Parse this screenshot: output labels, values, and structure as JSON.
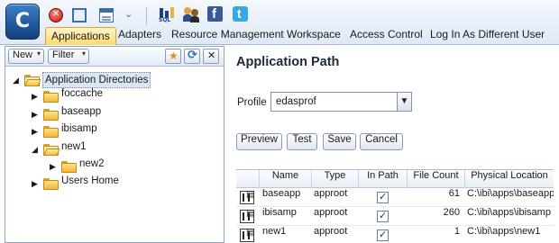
{
  "topbar": {
    "logo_letter": "C",
    "quick_tools": [
      "stop-icon",
      "window-icon",
      "window-list-icon",
      "chevron-down-icon",
      "sql-icon",
      "people-icon",
      "facebook-icon",
      "twitter-icon"
    ]
  },
  "menu": {
    "items": [
      {
        "label": "Applications",
        "active": true
      },
      {
        "label": "Adapters",
        "active": false
      },
      {
        "label": "Resource Management",
        "active": false
      },
      {
        "label": "Workspace",
        "active": false
      },
      {
        "label": "Access Control",
        "active": false
      },
      {
        "label": "Log In As Different User",
        "active": false
      }
    ]
  },
  "left_panel": {
    "new_label": "New",
    "filter_label": "Filter",
    "tree": {
      "root": "Application Directories",
      "nodes": [
        "foccache",
        "baseapp",
        "ibisamp",
        "new1",
        "new2",
        "Users Home"
      ]
    }
  },
  "right_panel": {
    "title": "Application Path",
    "profile_label": "Profile",
    "profile_value": "edasprof",
    "buttons": [
      "Preview",
      "Test",
      "Save",
      "Cancel"
    ],
    "table": {
      "columns": [
        "",
        "Name",
        "Type",
        "In Path",
        "File Count",
        "Physical Location"
      ],
      "rows": [
        {
          "name": "baseapp",
          "type": "approot",
          "in_path": true,
          "file_count": "61",
          "location": "C:\\ibi\\apps\\baseapp"
        },
        {
          "name": "ibisamp",
          "type": "approot",
          "in_path": true,
          "file_count": "260",
          "location": "C:\\ibi\\apps\\ibisamp"
        },
        {
          "name": "new1",
          "type": "approot",
          "in_path": true,
          "file_count": "1",
          "location": "C:\\ibi\\apps\\new1"
        }
      ]
    }
  },
  "colors": {
    "ribbon_top": "#f4f8fd",
    "ribbon_bottom": "#dfe9f6",
    "active_tab": "#ffd96a",
    "folder": "#f0b83a",
    "logo": "#1f5aa0"
  }
}
